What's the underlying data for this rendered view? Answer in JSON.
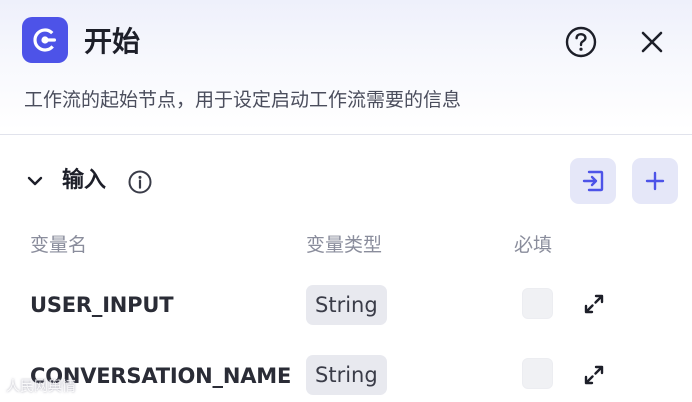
{
  "header": {
    "title": "开始",
    "description": "工作流的起始节点，用于设定启动工作流需要的信息",
    "node_icon": "start-node-icon",
    "help_icon": "question-circle-icon",
    "close_icon": "close-icon"
  },
  "input_section": {
    "title": "输入",
    "info_icon": "info-circle-icon",
    "collapse_icon": "chevron-down-icon",
    "import_icon": "import-icon",
    "add_icon": "plus-icon",
    "columns": {
      "name": "变量名",
      "type": "变量类型",
      "required": "必填"
    },
    "rows": [
      {
        "name": "USER_INPUT",
        "type": "String",
        "required": false
      },
      {
        "name": "CONVERSATION_NAME",
        "type": "String",
        "required": false
      }
    ]
  },
  "watermark": {
    "text": "人民网舆情"
  },
  "colors": {
    "accent": "#4d53e8",
    "action_button_bg": "#e5e7f8",
    "tag_bg": "#e8e9ef",
    "muted_text": "#8a8d9c"
  }
}
